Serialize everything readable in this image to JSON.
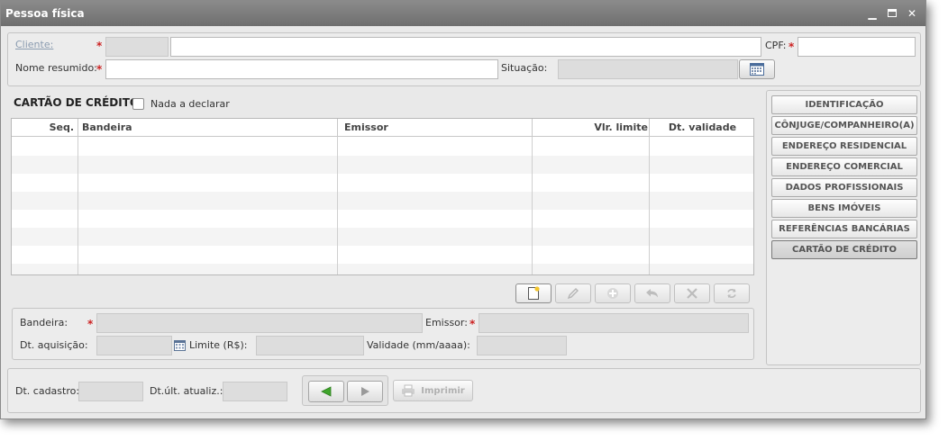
{
  "window": {
    "title": "Pessoa física",
    "icons": [
      "minimize-icon",
      "maximize-icon",
      "close-icon"
    ]
  },
  "header": {
    "cliente_label": "Cliente:",
    "cpf_label": "CPF:",
    "nome_resumido_label": "Nome resumido:",
    "situacao_label": "Situação:"
  },
  "credit": {
    "section_title": "CARTÃO DE CRÉDITO",
    "nada_label": "Nada a declarar",
    "columns": [
      "Seq.",
      "Bandeira",
      "Emissor",
      "Vlr. limite",
      "Dt. validade"
    ],
    "rows": []
  },
  "detail": {
    "bandeira_label": "Bandeira:",
    "emissor_label": "Emissor:",
    "dt_aquisicao_label": "Dt. aquisição:",
    "limite_label": "Limite (R$):",
    "validade_label": "Validade (mm/aaaa):"
  },
  "nav": {
    "items": [
      "IDENTIFICAÇÃO",
      "CÔNJUGE/COMPANHEIRO(A)",
      "ENDEREÇO RESIDENCIAL",
      "ENDEREÇO COMERCIAL",
      "DADOS PROFISSIONAIS",
      "BENS IMÓVEIS",
      "REFERÊNCIAS BANCÁRIAS",
      "CARTÃO DE CRÉDITO"
    ],
    "selected": "CARTÃO DE CRÉDITO"
  },
  "footer": {
    "dt_cadastro_label": "Dt. cadastro:",
    "dt_ult_label": "Dt.últ. atualiz.:",
    "imprimir_label": "Imprimir"
  },
  "colors": {
    "required": "#cc2222",
    "titlebar": "#7d7d7d",
    "nav_arrow": "#3fa52b"
  }
}
